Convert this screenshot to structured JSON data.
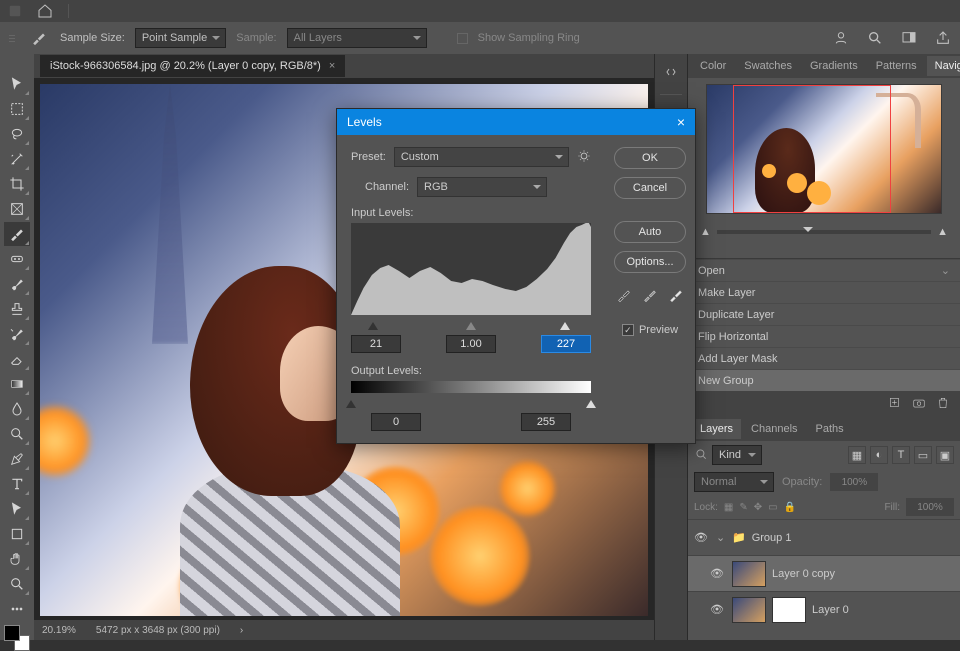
{
  "menubar": {},
  "optbar": {
    "sample_size_label": "Sample Size:",
    "sample_size_value": "Point Sample",
    "sample_label": "Sample:",
    "sample_value": "All Layers",
    "show_ring": "Show Sampling Ring"
  },
  "document": {
    "tab": "iStock-966306584.jpg @ 20.2% (Layer 0 copy, RGB/8*)",
    "zoom": "20.19%",
    "dims": "5472 px x 3648 px (300 ppi)"
  },
  "panels": {
    "top_tabs": [
      "Color",
      "Swatches",
      "Gradients",
      "Patterns",
      "Navigator"
    ],
    "history": [
      "Open",
      "Make Layer",
      "Duplicate Layer",
      "Flip Horizontal",
      "Add Layer Mask",
      "New Group"
    ],
    "layer_tabs": [
      "Layers",
      "Channels",
      "Paths"
    ],
    "kind_label": "Kind",
    "blend_mode": "Normal",
    "opacity_label": "Opacity:",
    "opacity": "100%",
    "lock_label": "Lock:",
    "fill_label": "Fill:",
    "fill": "100%",
    "layers": [
      {
        "name": "Group 1",
        "type": "group"
      },
      {
        "name": "Layer 0 copy",
        "type": "pixel"
      },
      {
        "name": "Layer 0",
        "type": "pixel_mask"
      }
    ]
  },
  "levels": {
    "title": "Levels",
    "preset_label": "Preset:",
    "preset": "Custom",
    "channel_label": "Channel:",
    "channel": "RGB",
    "input_label": "Input Levels:",
    "in_black": "21",
    "in_gamma": "1.00",
    "in_white": "227",
    "output_label": "Output Levels:",
    "out_black": "0",
    "out_white": "255",
    "ok": "OK",
    "cancel": "Cancel",
    "auto": "Auto",
    "options": "Options...",
    "preview": "Preview"
  }
}
